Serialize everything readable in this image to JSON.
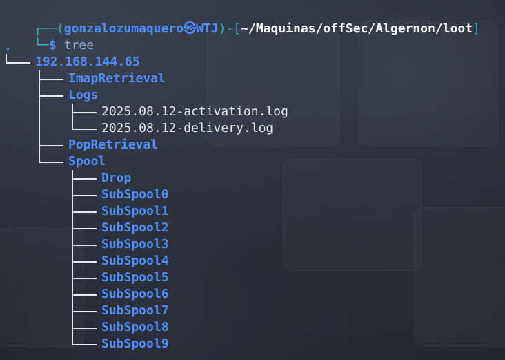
{
  "prompt": {
    "corner_top": "┌──(",
    "user": "gonzalozumaquero",
    "at_symbol": "㉿",
    "host": "WTJ",
    "sep": ")-[",
    "path": "~/Maquinas/offSec/Algernon/loot",
    "close": "]",
    "corner_bottom": "└─",
    "dollar": "$",
    "command": "tree"
  },
  "tree": {
    "root": ".",
    "host_dir": "192.168.144.65",
    "level1": [
      "ImapRetrieval",
      "Logs",
      "PopRetrieval",
      "Spool"
    ],
    "logs_files": [
      "2025.08.12-activation.log",
      "2025.08.12-delivery.log"
    ],
    "spool_dirs": [
      "Drop",
      "SubSpool0",
      "SubSpool1",
      "SubSpool2",
      "SubSpool3",
      "SubSpool4",
      "SubSpool5",
      "SubSpool6",
      "SubSpool7",
      "SubSpool8",
      "SubSpool9"
    ]
  },
  "colors": {
    "prompt_frame": "#2bb3c7",
    "directory": "#4e8df5",
    "file": "#e3e6eb",
    "path": "#ffffff"
  }
}
